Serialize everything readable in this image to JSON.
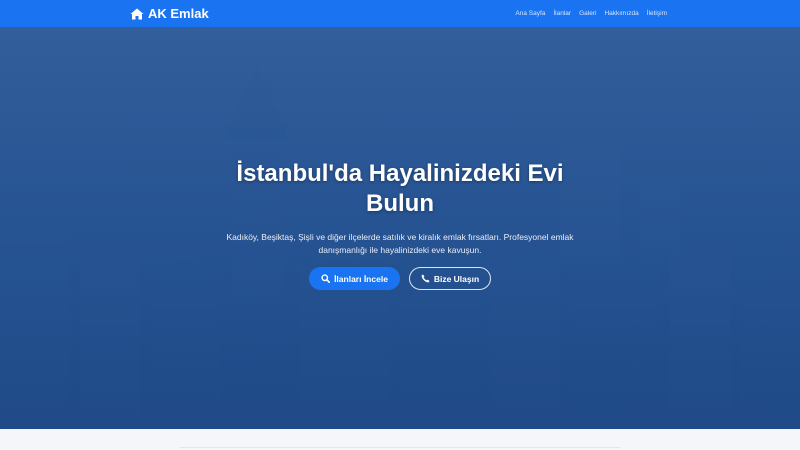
{
  "brand": {
    "name": "AK Emlak",
    "icon": "home-icon"
  },
  "nav": {
    "items": [
      {
        "label": "Ana Sayfa"
      },
      {
        "label": "İlanlar"
      },
      {
        "label": "Galeri"
      },
      {
        "label": "Hakkımızda"
      },
      {
        "label": "İletişim"
      }
    ]
  },
  "hero": {
    "title": "İstanbul'da Hayalinizdeki Evi Bulun",
    "subtitle": "Kadıköy, Beşiktaş, Şişli ve diğer ilçelerde satılık ve kiralık emlak fırsatları. Profesyonel emlak danışmanlığı ile hayalinizdeki eve kavuşun.",
    "primary_button": {
      "label": "İlanları İncele",
      "icon": "search-icon"
    },
    "secondary_button": {
      "label": "Bize Ulaşın",
      "icon": "phone-icon"
    }
  },
  "colors": {
    "primary": "#1a74f2",
    "hero_overlay": "#2a5590",
    "text_light": "#ffffff",
    "page_bg": "#f4f6f9"
  }
}
